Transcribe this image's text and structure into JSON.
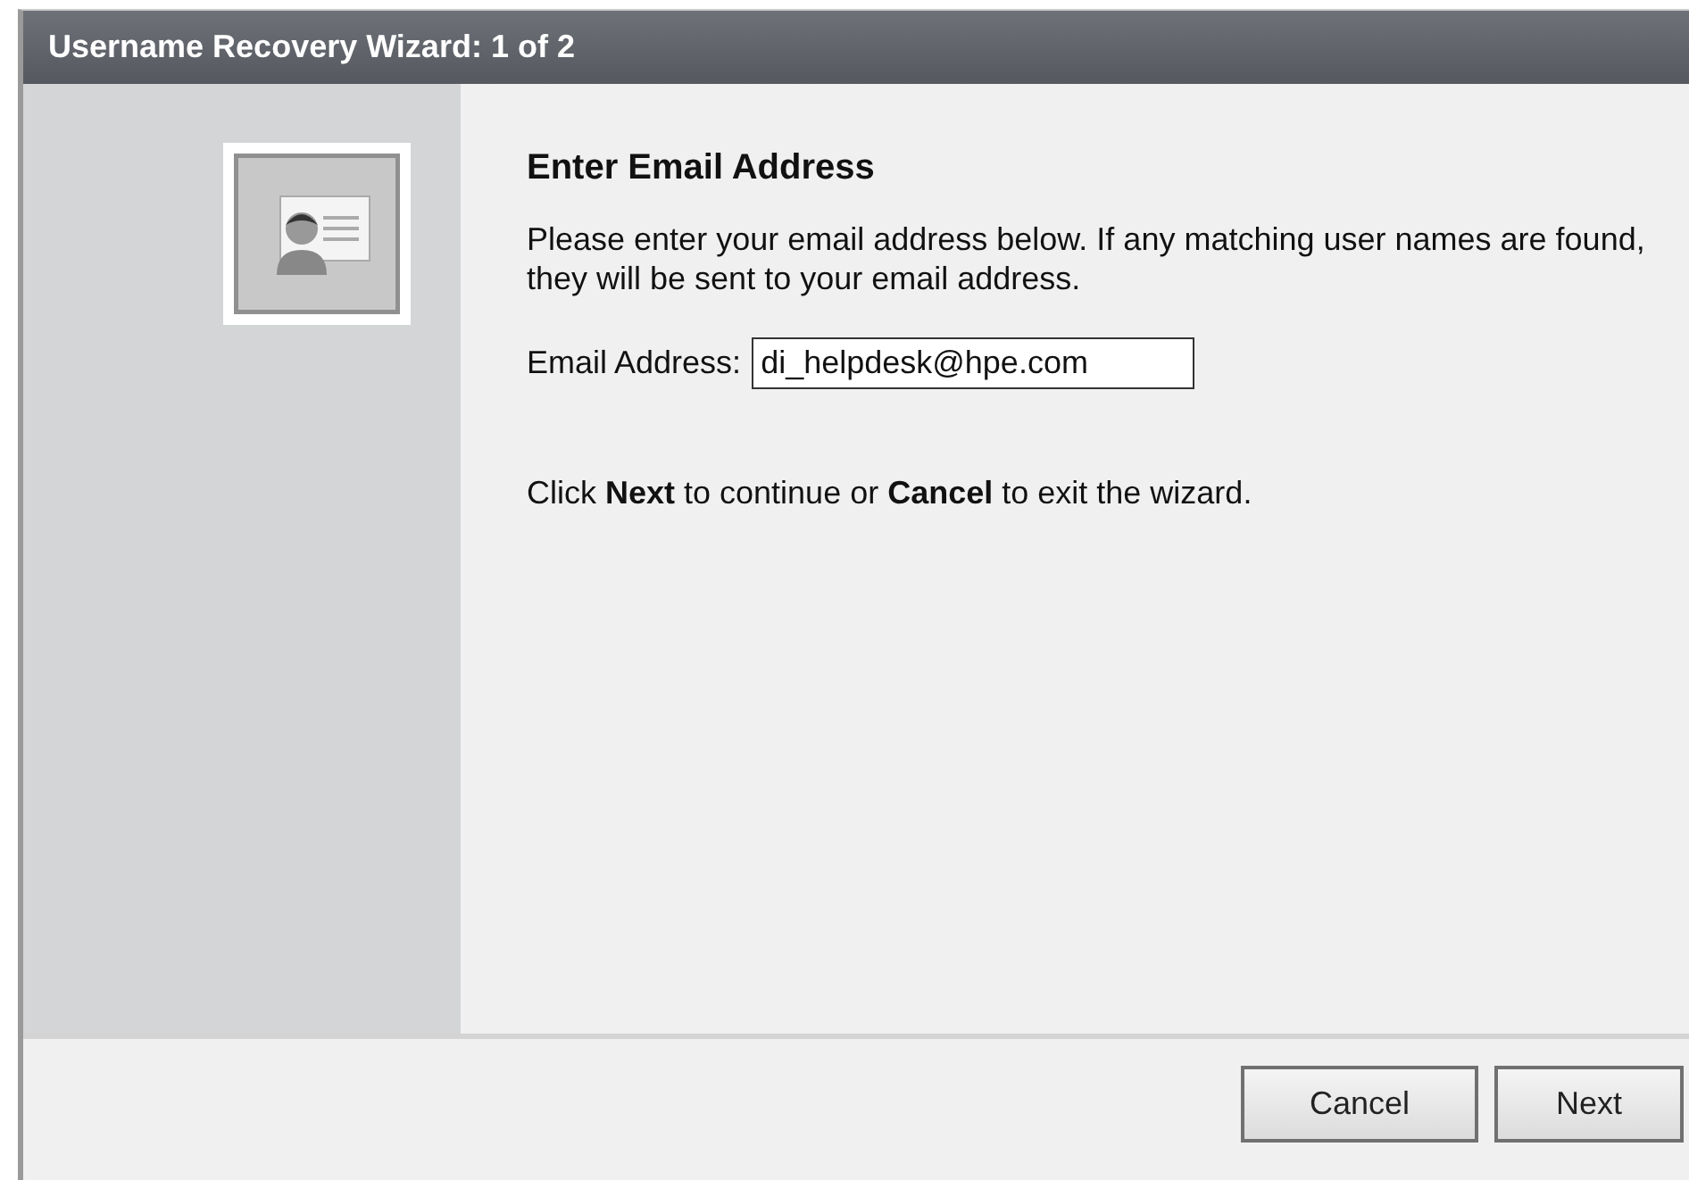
{
  "window": {
    "title": "Username Recovery Wizard: 1 of 2"
  },
  "content": {
    "heading": "Enter Email Address",
    "description": "Please enter your email address below. If any matching user names are found, they will be sent to your email address.",
    "email_field": {
      "label": "Email Address:",
      "value": "di_helpdesk@hpe.com"
    },
    "instruction": "Click **Next** to continue or **Cancel** to exit the wizard."
  },
  "buttons": [
    {
      "label": "Cancel"
    },
    {
      "label": "Next"
    }
  ]
}
